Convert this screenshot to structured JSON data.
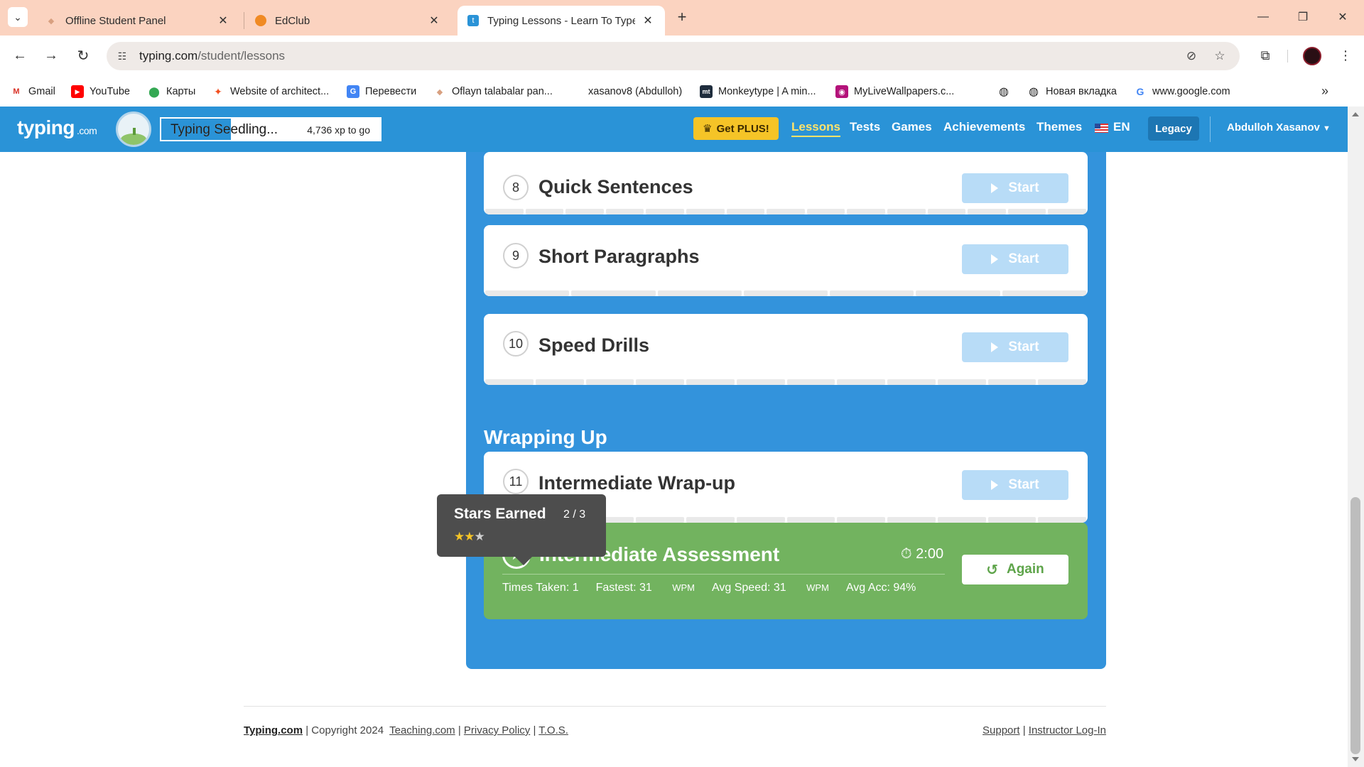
{
  "browser": {
    "tabs": [
      {
        "title": "Offline Student Panel",
        "active": false
      },
      {
        "title": "EdClub",
        "active": false
      },
      {
        "title": "Typing Lessons - Learn To Type",
        "active": true
      }
    ],
    "url_host": "typing.com",
    "url_path": "/student/lessons",
    "bookmarks": [
      "Gmail",
      "YouTube",
      "Карты",
      "Website of architect...",
      "Перевести",
      "Oflayn talabalar pan...",
      "xasanov8 (Abdulloh)",
      "Monkeytype | A min...",
      "MyLiveWallpapers.c...",
      "",
      "Новая вкладка",
      "www.google.com"
    ]
  },
  "site": {
    "logo": "typing",
    "logo_suffix": ".com",
    "rank_title": "Typing Seedling...",
    "xp_to_go": "4,736 xp to go",
    "get_plus": "Get PLUS!",
    "nav": [
      "Lessons",
      "Tests",
      "Games",
      "Achievements",
      "Themes"
    ],
    "language": "EN",
    "legacy": "Legacy",
    "user": "Abdulloh Xasanov"
  },
  "lessons": [
    {
      "number": "8",
      "title": "Quick Sentences",
      "action": "Start"
    },
    {
      "number": "9",
      "title": "Short Paragraphs",
      "action": "Start"
    },
    {
      "number": "10",
      "title": "Speed Drills",
      "action": "Start"
    }
  ],
  "wrapping_up": {
    "heading": "Wrapping Up",
    "lesson": {
      "number": "11",
      "title": "Intermediate Wrap-up",
      "action": "Start"
    },
    "assessment": {
      "title": "Intermediate Assessment",
      "time": "2:00",
      "action": "Again",
      "times_taken": "Times Taken: 1",
      "fastest_label": "Fastest: 31",
      "avg_speed_label": "Avg Speed: 31",
      "wpm": "WPM",
      "avg_acc": "Avg Acc: 94%"
    }
  },
  "tooltip": {
    "title": "Stars Earned",
    "count": "2 / 3",
    "stars_earned": 2,
    "stars_total": 3
  },
  "footer": {
    "brand": "Typing.com",
    "copyright": "| Copyright 2024",
    "links": [
      "Teaching.com",
      "Privacy Policy",
      "T.O.S."
    ],
    "right_links": [
      "Support",
      "Instructor Log-In"
    ]
  },
  "colors": {
    "tabstrip": "#fbd3c0",
    "site_header": "#2a93d7",
    "lesson_panel": "#3393dc",
    "assessment_green": "#72b35f",
    "plus_gold": "#f5c427"
  }
}
